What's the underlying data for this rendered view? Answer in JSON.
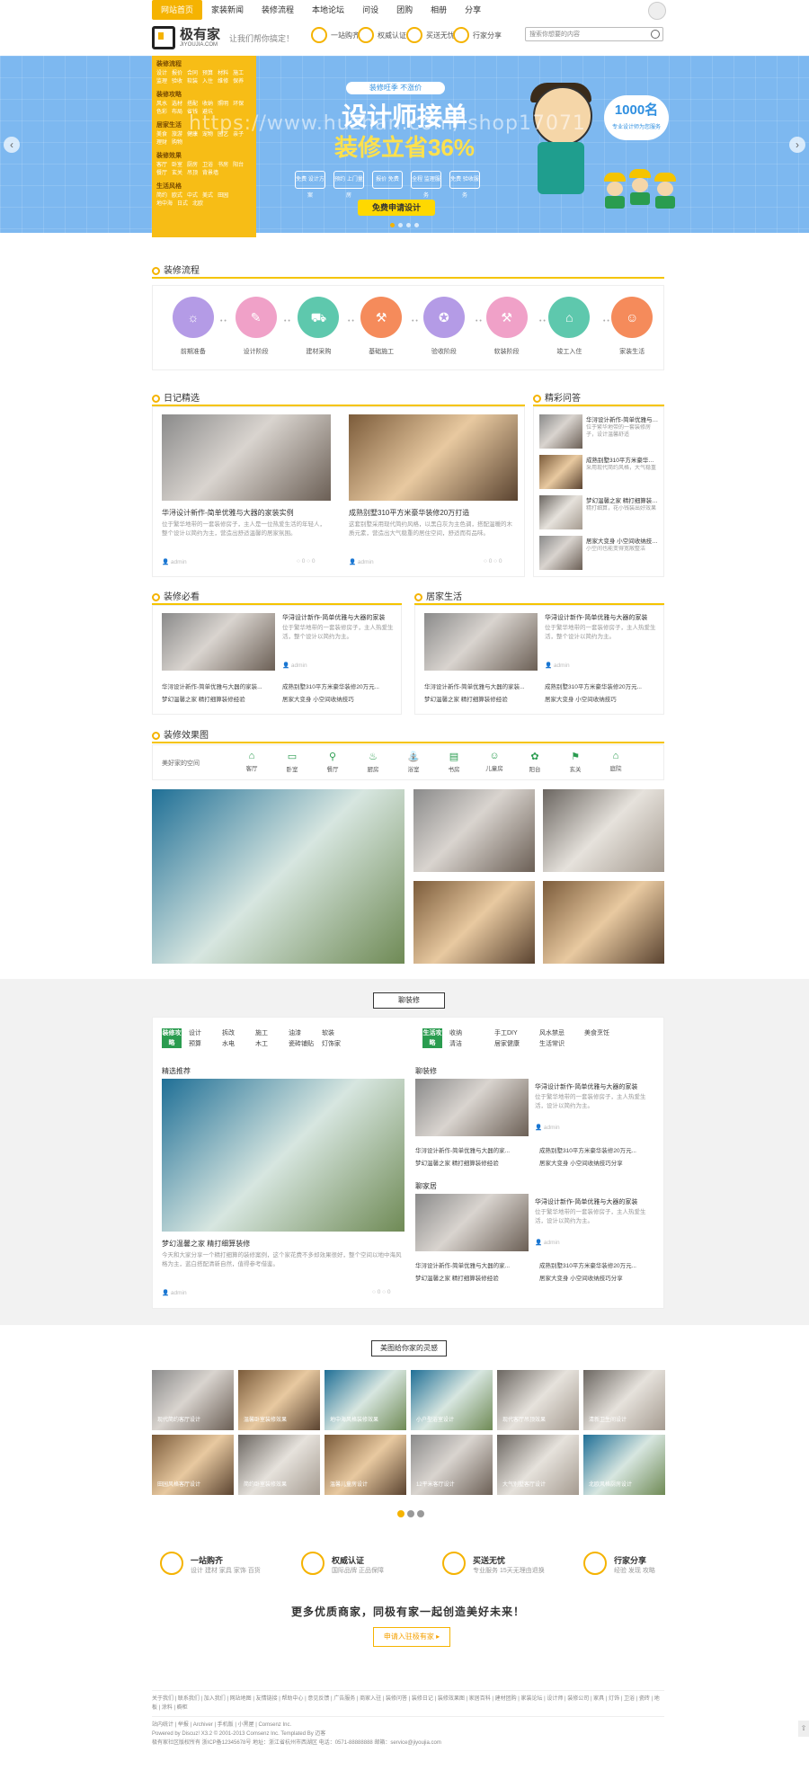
{
  "topnav": [
    "网站首页",
    "家装新闻",
    "装修流程",
    "本地论坛",
    "问设",
    "团购",
    "相册",
    "分享"
  ],
  "header": {
    "logo_name": "极有家",
    "logo_en": "JIYOUJIA.COM",
    "slogan": "让我们帮你搞定！",
    "feats": [
      "一站购齐",
      "权威认证",
      "买送无忧",
      "行家分享"
    ],
    "search_placeholder": "搜索你想要的内容"
  },
  "watermark": "https://www.huzhan.com/ishop17071",
  "banner": {
    "top": "装修旺季 不涨价",
    "big1": "设计师接单",
    "big2": "装修立省36%",
    "steps": [
      "免费 设计方案",
      "预约 上门量房",
      "报价 免费",
      "全程 监理服务",
      "免费 验收服务"
    ],
    "btn": "免费申请设计",
    "badge_n": "1000名",
    "badge_s": "专业设计师为您服务"
  },
  "catpanel": [
    {
      "t": "装修流程",
      "links": [
        "设计",
        "报价",
        "合同",
        "预算",
        "材料",
        "施工",
        "监理",
        "验收",
        "软装",
        "入住",
        "维修",
        "保养"
      ]
    },
    {
      "t": "装修攻略",
      "links": [
        "风水",
        "选材",
        "搭配",
        "收纳",
        "照明",
        "环保",
        "色彩",
        "布局",
        "省钱",
        "避坑"
      ]
    },
    {
      "t": "居家生活",
      "links": [
        "美食",
        "旅游",
        "健康",
        "宠物",
        "园艺",
        "亲子",
        "理财",
        "购物"
      ]
    },
    {
      "t": "装修效果",
      "links": [
        "客厅",
        "卧室",
        "厨房",
        "卫浴",
        "书房",
        "阳台",
        "餐厅",
        "玄关",
        "吊顶",
        "背景墙"
      ]
    },
    {
      "t": "生活风格",
      "links": [
        "简约",
        "欧式",
        "中式",
        "美式",
        "田园",
        "地中海",
        "日式",
        "北欧"
      ]
    }
  ],
  "sections": {
    "process": "装修流程",
    "diary": "日记精选",
    "qa": "精彩问答",
    "must": "装修必看",
    "life": "居家生活",
    "effect": "装修效果图",
    "zhuang": "聊装修",
    "inspire": "美图给你家的灵感"
  },
  "process": [
    "前期准备",
    "设计阶段",
    "建材采购",
    "基础施工",
    "验收阶段",
    "软装阶段",
    "竣工入住",
    "家装生活"
  ],
  "diary": [
    {
      "title": "华浔设计新作-简单优雅与大器的家装实例",
      "desc": "位于繁华地带的一套装修房子，主人是一位热爱生活的年轻人，整个设计以简约为主，营造出舒适温馨的居家氛围。",
      "author": "admin"
    },
    {
      "title": "成熟别墅310平方米豪华装修20万打造",
      "desc": "这套别墅采用现代简约风格，以黑白灰为主色调，搭配温暖的木质元素，营造出大气稳重的居住空间，舒适而有品味。",
      "author": "admin"
    }
  ],
  "qa": [
    "华浔设计新作-简单优雅与大器的家装",
    "成熟别墅310平方米豪华装修20万",
    "梦幻温馨之家 精打细算装修经验",
    "居家大变身 小空间收纳技巧分享"
  ],
  "qa_desc": [
    "位于繁华地带的一套装修房子，设计温馨舒适",
    "采用现代简约风格，大气稳重",
    "精打细算，花小钱装出好效果",
    "小空间也能变得宽敞整洁"
  ],
  "must": {
    "title": "华浔设计新作-简单优雅与大器的家装",
    "desc": "位于繁华地带的一套装修房子，主人热爱生活，整个设计以简约为主。",
    "author": "admin",
    "list": [
      "华浔设计新作-简单优雅与大器的家装...",
      "成熟别墅310平方米豪华装修20万元...",
      "梦幻温馨之家 精打细算装修经验",
      "居家大变身 小空间收纳技巧"
    ]
  },
  "life": {
    "title": "华浔设计新作-简单优雅与大器的家装",
    "desc": "位于繁华地带的一套装修房子，主人热爱生活，整个设计以简约为主。",
    "author": "admin",
    "list": [
      "华浔设计新作-简单优雅与大器的家装...",
      "成熟别墅310平方米豪华装修20万元...",
      "梦幻温馨之家 精打细算装修经验",
      "居家大变身 小空间收纳技巧"
    ]
  },
  "fx_tabs": {
    "label": "美好家的空间",
    "items": [
      "客厅",
      "卧室",
      "餐厅",
      "厨房",
      "浴室",
      "书房",
      "儿童房",
      "阳台",
      "玄关",
      "庭院"
    ]
  },
  "zhuang": {
    "tag1": "装修攻略",
    "row1a": [
      "设计",
      "拆改",
      "施工",
      "油漆",
      "软装"
    ],
    "row1b": [
      "预算",
      "水电",
      "木工",
      "瓷砖铺贴",
      "灯饰家"
    ],
    "tag2": "生活攻略",
    "row2a": [
      "收纳",
      "手工DIY",
      "风水禁忌",
      "美食烹饪"
    ],
    "row2b": [
      "清洁",
      "居家健康",
      "生活常识"
    ],
    "featured_h": "精选推荐",
    "featured_title": "梦幻温馨之家 精打细算装修",
    "featured_desc": "今天和大家分享一个精打细算的装修案例，这个家花费不多却效果很好，整个空间以地中海风格为主，蓝白搭配清新自然，值得参考借鉴。",
    "featured_author": "admin",
    "col_a": "聊装修",
    "col_b": "聊家居",
    "a_title": "华浔设计新作-简单优雅与大器的家装",
    "a_desc": "位于繁华地带的一套装修房子，主人热爱生活，设计以简约为主。",
    "a_author": "admin",
    "a_list": [
      "华浔设计新作-简单优雅与大器的家...",
      "成熟别墅310平方米豪华装修20万元...",
      "梦幻温馨之家 精打细算装修经验",
      "居家大变身 小空间收纳技巧分享"
    ],
    "b_title": "华浔设计新作-简单优雅与大器的家装",
    "b_desc": "位于繁华地带的一套装修房子，主人热爱生活，设计以简约为主。",
    "b_author": "admin",
    "b_list": [
      "华浔设计新作-简单优雅与大器的家...",
      "成熟别墅310平方米豪华装修20万元...",
      "梦幻温馨之家 精打细算装修经验",
      "居家大变身 小空间收纳技巧分享"
    ]
  },
  "inspire": [
    "现代简约客厅设计",
    "温馨卧室装修效果",
    "地中海风格装修效果",
    "小户型浴室设计",
    "现代客厅吊顶效果",
    "清新卫生间设计",
    "田园风格客厅设计",
    "简约卧室装修效果",
    "温馨儿童房设计",
    "12平米客厅设计",
    "大气别墅客厅设计",
    "北欧风格厨房设计"
  ],
  "features": [
    {
      "h": "一站购齐",
      "s": "设计 建材 家具 家饰 百货"
    },
    {
      "h": "权威认证",
      "s": "国际品牌 正品保障"
    },
    {
      "h": "买送无忧",
      "s": "专业服务 15天无理由退换"
    },
    {
      "h": "行家分享",
      "s": "经验 发现 攻略"
    }
  ],
  "slogan": "更多优质商家，同极有家一起创造美好未来！",
  "apply": "申请入驻极有家 ▸",
  "footer": {
    "links": "关于我们 | 联系我们 | 加入我们 | 网站地图 | 友情链接 | 帮助中心 | 意见反馈 | 广告服务 | 商家入驻 | 装修问答 | 装修日记 | 装修效果图 | 家居百科 | 建材团购 | 家装论坛 | 设计师 | 装修公司 | 家具 | 灯饰 | 卫浴 | 瓷砖 | 地板 | 涂料 | 橱柜",
    "l2": "站内统计 | 举报 | Archiver | 手机版 | 小黑屋 | Comsenz Inc.",
    "l3": "Powered by Discuz! X3.2 © 2001-2013 Comsenz Inc. Templated By 迈客",
    "l4": "极有家社区版权所有 浙ICP备12345678号 地址：浙江省杭州市西湖区 电话：0571-88888888 邮箱：service@jiyoujia.com"
  },
  "colors": {
    "accent": "#f5b301",
    "green": "#2a9c4f"
  }
}
